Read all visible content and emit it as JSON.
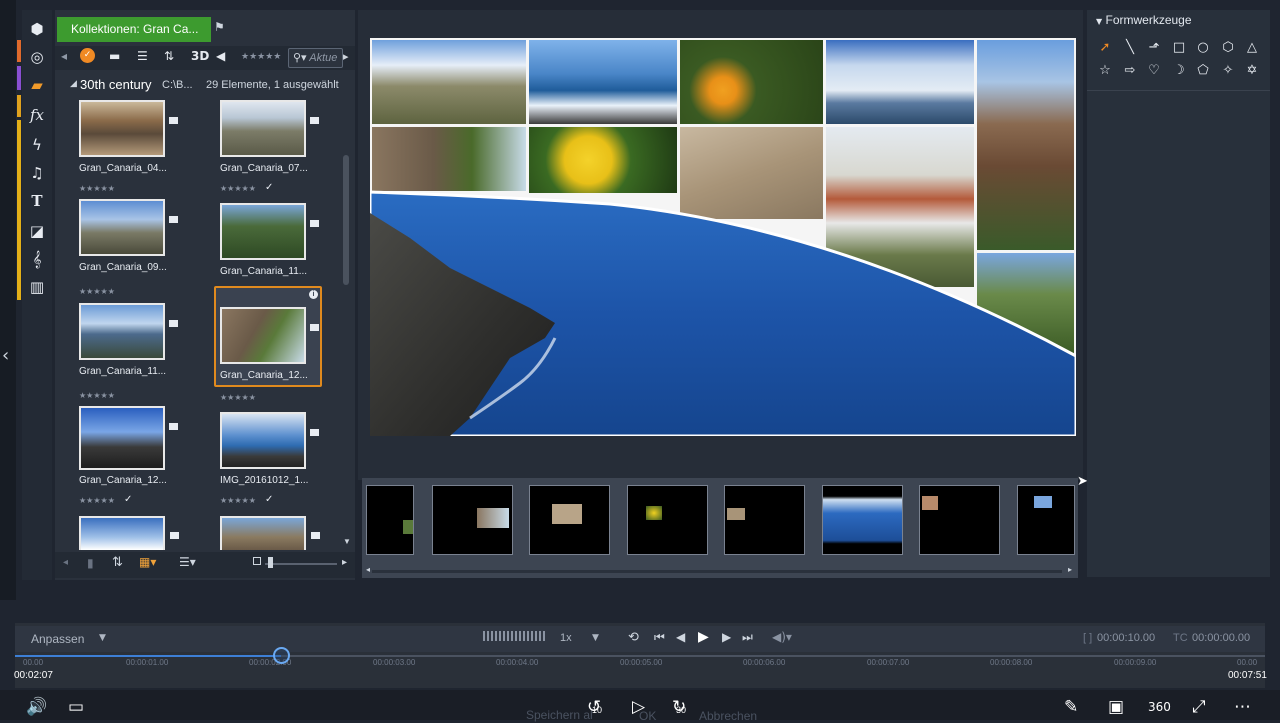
{
  "library": {
    "tab_label": "Kollektionen: Gran Ca...",
    "search_placeholder": "Aktue",
    "toolbar_3d": "3D",
    "folder_name": "30th century",
    "path_short": "C:\\B...",
    "count_text": "29 Elemente, 1 ausgewählt",
    "items": [
      {
        "name": "Gran_Canaria_04...",
        "stars": "★★★★★",
        "check": ""
      },
      {
        "name": "Gran_Canaria_07...",
        "stars": "★★★★★",
        "check": "✓"
      },
      {
        "name": "Gran_Canaria_09...",
        "stars": "★★★★★",
        "check": ""
      },
      {
        "name": "Gran_Canaria_11...",
        "stars": "★★★★★",
        "check": ""
      },
      {
        "name": "Gran_Canaria_11...",
        "stars": "★★★★★",
        "check": ""
      },
      {
        "name": "Gran_Canaria_12...",
        "stars": "★★★★★",
        "check": ""
      },
      {
        "name": "Gran_Canaria_12...",
        "stars": "★★★★★",
        "check": "✓"
      },
      {
        "name": "IMG_20161012_1...",
        "stars": "★★★★★",
        "check": "✓"
      }
    ]
  },
  "shape_panel": {
    "title": "Formwerkzeuge",
    "tools": [
      "arrow-pointer-icon",
      "line-icon",
      "arrow-line-icon",
      "rectangle-icon",
      "circle-icon",
      "hexagon-icon",
      "triangle-icon",
      "star5-icon",
      "arrow-right-icon",
      "heart-icon",
      "crescent-icon",
      "pentagon-icon",
      "star4-icon",
      "star6-icon"
    ]
  },
  "timeline": {
    "fit_label": "Anpassen",
    "speed": "1x",
    "in_duration": "00:00:10.00",
    "tc_label": "TC",
    "tc_value": "00:00:00.00",
    "ruler_labels": [
      "00.00",
      "00:00:01.00",
      "00:00:02.00",
      "00:00:03.00",
      "00:00:04.00",
      "00:00:05.00",
      "00:00:06.00",
      "00:00:07.00",
      "00:00:08.00",
      "00:00:09.00",
      "00.00"
    ],
    "current_time": "00:02:07",
    "total_time": "00:07:51",
    "progress_fraction": 0.213
  },
  "player": {
    "rewind_label": "10",
    "forward_label": "30",
    "save_label": "Speichern al",
    "ok_label": "OK",
    "cancel_label": "Abbrechen"
  },
  "colors": {
    "accent_green": "#3d9b2f",
    "selection_orange": "#e08a1e",
    "progress_blue": "#3d7fd6"
  }
}
